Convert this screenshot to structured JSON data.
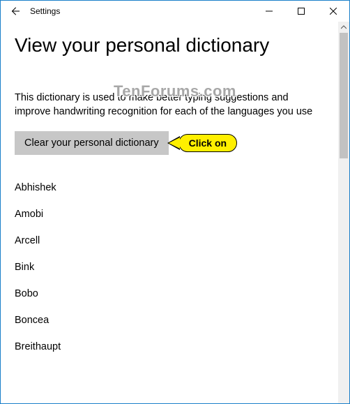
{
  "titlebar": {
    "title": "Settings"
  },
  "page": {
    "heading": "View your personal dictionary",
    "description": "This dictionary is used to make better typing suggestions and improve handwriting recognition for each of the languages you use",
    "clear_button_label": "Clear your personal dictionary"
  },
  "callout": {
    "text": "Click on"
  },
  "words": {
    "items": [
      "Abhishek",
      "Amobi",
      "Arcell",
      "Bink",
      "Bobo",
      "Boncea",
      "Breithaupt"
    ]
  },
  "watermark": "TenForums.com"
}
